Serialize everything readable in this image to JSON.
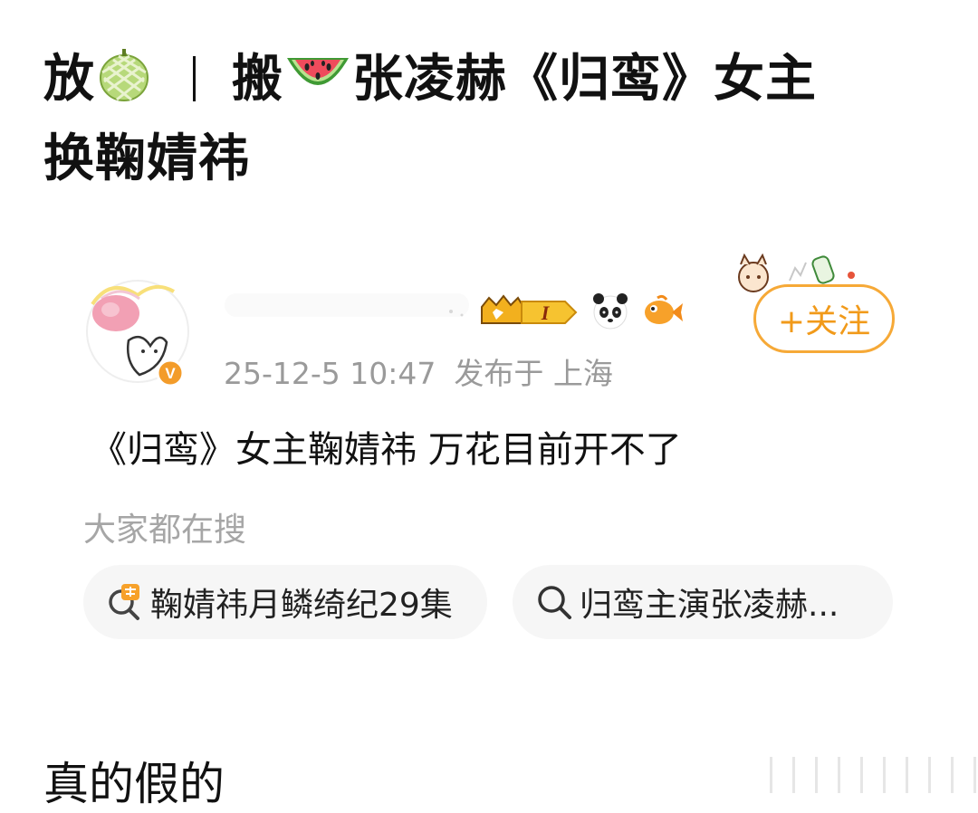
{
  "headline": {
    "line1_part1": "放",
    "line1_part2": "搬",
    "line1_part3": "张凌赫《归鸾》女主",
    "line2": "换鞠婧祎",
    "emoji_1": "melon-icon",
    "emoji_2": "watermelon-icon"
  },
  "post": {
    "timestamp": "25-12-5 10:47",
    "location": "发布于 上海",
    "follow_label": "+关注",
    "verified_label": "V",
    "level_badge": "I",
    "text": "《归鸾》女主鞠婧祎 万花目前开不了"
  },
  "search": {
    "heading": "大家都在搜",
    "chips": [
      {
        "label": "鞠婧祎月鳞绮纪29集",
        "icon": "hot-search-icon"
      },
      {
        "label": "归鸾主演张凌赫...",
        "icon": "search-icon"
      }
    ]
  },
  "comment": {
    "text": "真的假的"
  },
  "colors": {
    "accent_orange": "#f6a937",
    "meta_gray": "#9a9a9a",
    "chip_bg": "#f6f6f6"
  }
}
